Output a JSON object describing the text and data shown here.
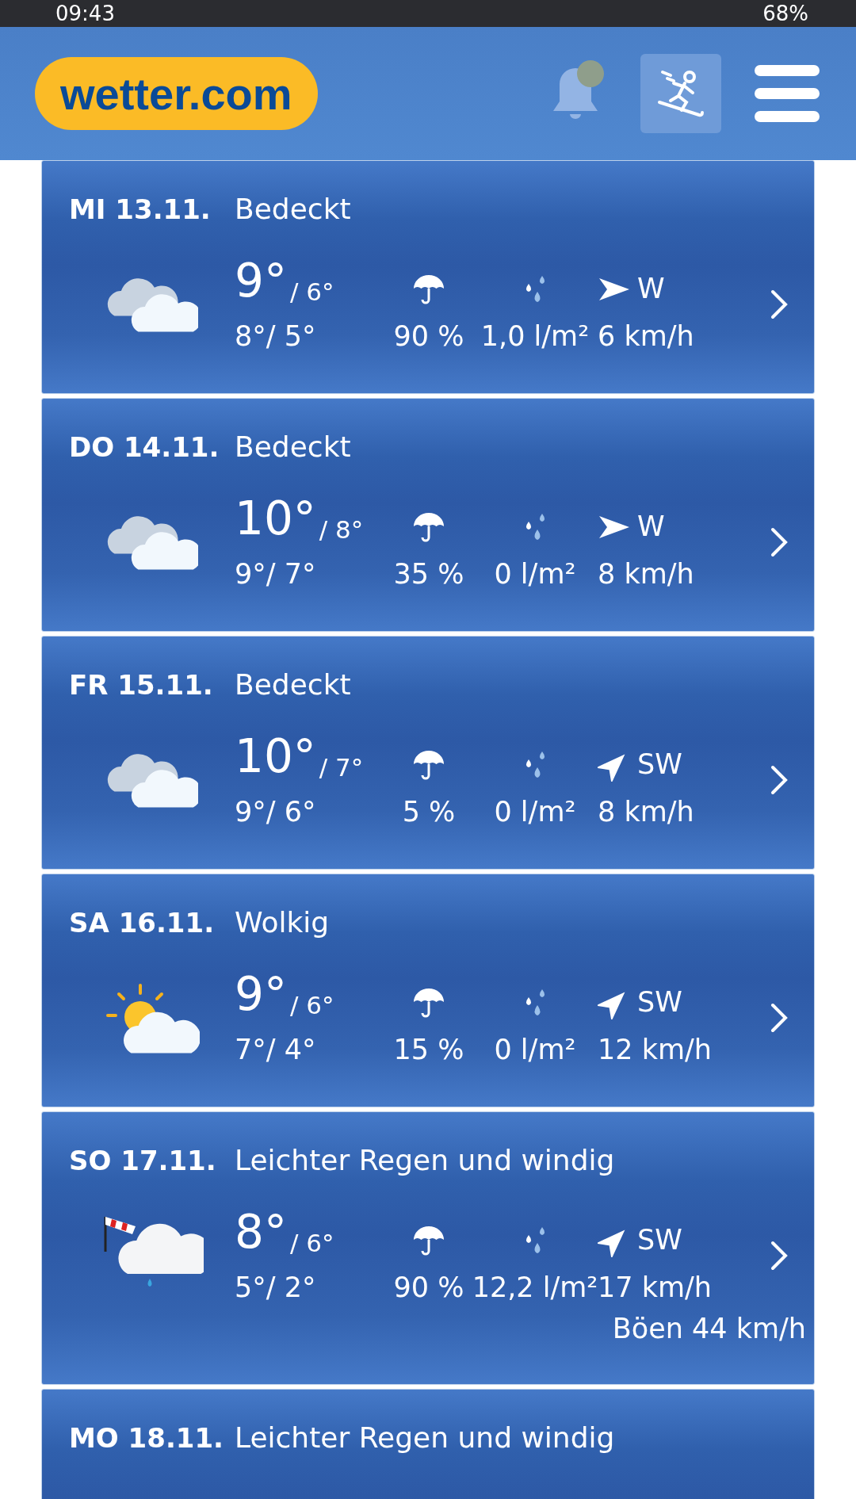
{
  "status_bar": {
    "time": "09:43",
    "battery": "68%"
  },
  "header": {
    "logo": "wetter.com",
    "notification_dot": true
  },
  "days": [
    {
      "date": "MI 13.11.",
      "description": "Bedeckt",
      "kind": "overcast",
      "high": "9°",
      "high_night": "/ 6°",
      "low": "8°/ 5°",
      "precip_chance": "90 %",
      "precip_amount": "1,0 l/m²",
      "wind": {
        "kind": "east",
        "direction": "W",
        "speed": "6 km/h"
      }
    },
    {
      "date": "DO 14.11.",
      "description": "Bedeckt",
      "kind": "overcast",
      "high": "10°",
      "high_night": "/ 8°",
      "low": "9°/ 7°",
      "precip_chance": "35 %",
      "precip_amount": "0 l/m²",
      "wind": {
        "kind": "east",
        "direction": "W",
        "speed": "8 km/h"
      }
    },
    {
      "date": "FR 15.11.",
      "description": "Bedeckt",
      "kind": "overcast",
      "high": "10°",
      "high_night": "/ 7°",
      "low": "9°/ 6°",
      "precip_chance": "5 %",
      "precip_amount": "0 l/m²",
      "wind": {
        "kind": "northeast",
        "direction": "SW",
        "speed": "8 km/h"
      }
    },
    {
      "date": "SA 16.11.",
      "description": "Wolkig",
      "kind": "partly_sunny",
      "high": "9°",
      "high_night": "/ 6°",
      "low": "7°/ 4°",
      "precip_chance": "15 %",
      "precip_amount": "0 l/m²",
      "wind": {
        "kind": "northeast",
        "direction": "SW",
        "speed": "12 km/h"
      }
    },
    {
      "date": "SO 17.11.",
      "description": "Leichter Regen und windig",
      "kind": "rain_windy",
      "high": "8°",
      "high_night": "/ 6°",
      "low": "5°/ 2°",
      "precip_chance": "90 %",
      "precip_amount": "12,2 l/m²",
      "wind": {
        "kind": "northeast",
        "direction": "SW",
        "speed": "17 km/h"
      },
      "gusts": "Böen 44 km/h"
    },
    {
      "date": "MO 18.11.",
      "description": "Leichter Regen und windig"
    }
  ]
}
